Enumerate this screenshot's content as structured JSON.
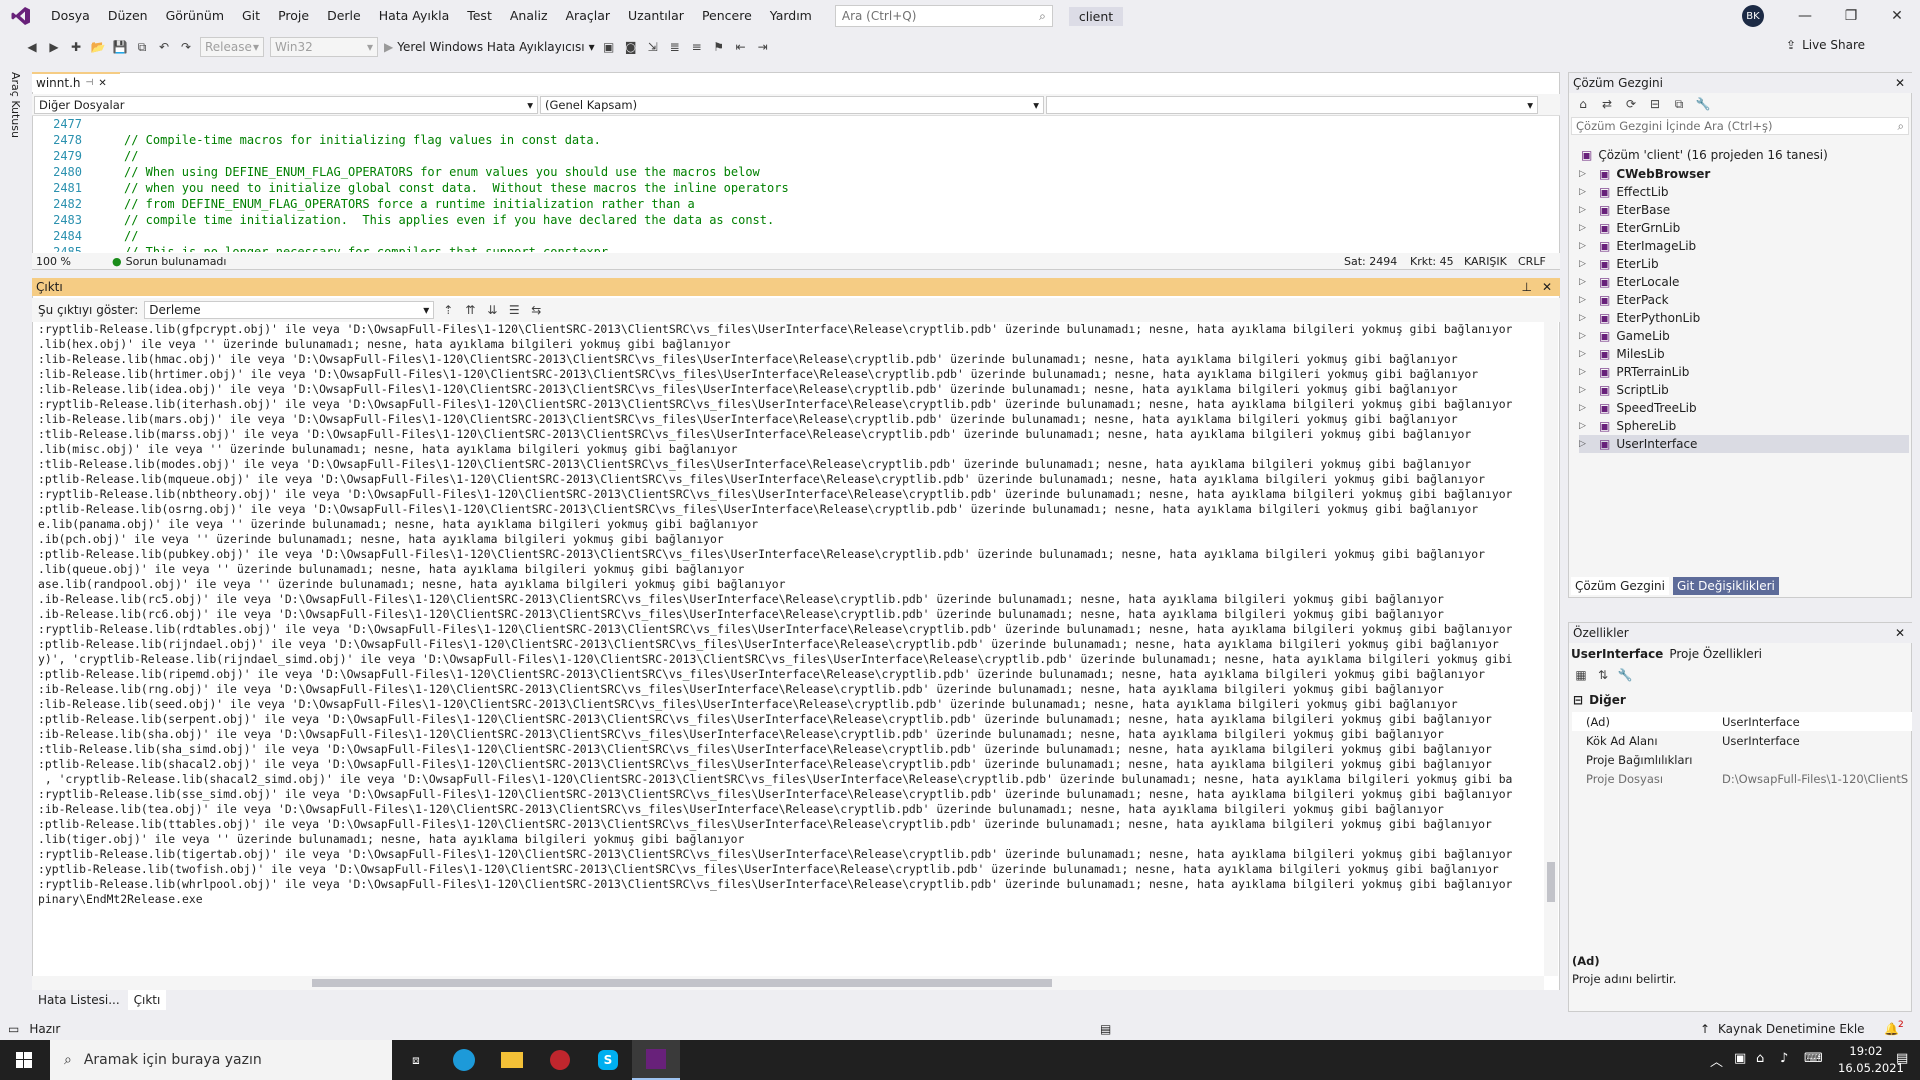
{
  "menu": [
    "Dosya",
    "Düzen",
    "Görünüm",
    "Git",
    "Proje",
    "Derle",
    "Hata Ayıkla",
    "Test",
    "Analiz",
    "Araçlar",
    "Uzantılar",
    "Pencere",
    "Yardım"
  ],
  "search": {
    "placeholder": "Ara (Ctrl+Q)"
  },
  "window_title": "client",
  "user_initials": "BK",
  "toolbar": {
    "config": "Release",
    "platform": "Win32",
    "debugger": "Yerel Windows Hata Ayıklayıcısı",
    "live_share": "Live Share"
  },
  "side_tab": "Araç Kutusu",
  "editor": {
    "tab": "winnt.h",
    "nav_left": "Diğer Dosyalar",
    "nav_mid": "(Genel Kapsam)",
    "lines": [
      {
        "n": "2477",
        "t": ""
      },
      {
        "n": "2478",
        "t": "// Compile-time macros for initializing flag values in const data."
      },
      {
        "n": "2479",
        "t": "//"
      },
      {
        "n": "2480",
        "t": "// When using DEFINE_ENUM_FLAG_OPERATORS for enum values you should use the macros below"
      },
      {
        "n": "2481",
        "t": "// when you need to initialize global const data.  Without these macros the inline operators"
      },
      {
        "n": "2482",
        "t": "// from DEFINE_ENUM_FLAG_OPERATORS force a runtime initialization rather than a"
      },
      {
        "n": "2483",
        "t": "// compile time initialization.  This applies even if you have declared the data as const."
      },
      {
        "n": "2484",
        "t": "//"
      },
      {
        "n": "2485",
        "t": "// This is no longer necessary for compilers that support constexpr."
      }
    ],
    "zoom": "100 %",
    "issues": "Sorun bulunamadı",
    "line": "Sat: 2494",
    "col": "Krkt: 45",
    "mode": "KARIŞIK",
    "eol": "CRLF"
  },
  "output": {
    "title": "Çıktı",
    "show_label": "Şu çıktıyı göster:",
    "source": "Derleme",
    "lines": [
      ":ryptlib-Release.lib(gfpcrypt.obj)' ile veya 'D:\\OwsapFull-Files\\1-120\\ClientSRC-2013\\ClientSRC\\vs_files\\UserInterface\\Release\\cryptlib.pdb' üzerinde bulunamadı; nesne, hata ayıklama bilgileri yokmuş gibi bağlanıyor",
      ".lib(hex.obj)' ile veya '' üzerinde bulunamadı; nesne, hata ayıklama bilgileri yokmuş gibi bağlanıyor",
      ":lib-Release.lib(hmac.obj)' ile veya 'D:\\OwsapFull-Files\\1-120\\ClientSRC-2013\\ClientSRC\\vs_files\\UserInterface\\Release\\cryptlib.pdb' üzerinde bulunamadı; nesne, hata ayıklama bilgileri yokmuş gibi bağlanıyor",
      ":lib-Release.lib(hrtimer.obj)' ile veya 'D:\\OwsapFull-Files\\1-120\\ClientSRC-2013\\ClientSRC\\vs_files\\UserInterface\\Release\\cryptlib.pdb' üzerinde bulunamadı; nesne, hata ayıklama bilgileri yokmuş gibi bağlanıyor",
      ":lib-Release.lib(idea.obj)' ile veya 'D:\\OwsapFull-Files\\1-120\\ClientSRC-2013\\ClientSRC\\vs_files\\UserInterface\\Release\\cryptlib.pdb' üzerinde bulunamadı; nesne, hata ayıklama bilgileri yokmuş gibi bağlanıyor",
      ":ryptlib-Release.lib(iterhash.obj)' ile veya 'D:\\OwsapFull-Files\\1-120\\ClientSRC-2013\\ClientSRC\\vs_files\\UserInterface\\Release\\cryptlib.pdb' üzerinde bulunamadı; nesne, hata ayıklama bilgileri yokmuş gibi bağlanıyor",
      ":lib-Release.lib(mars.obj)' ile veya 'D:\\OwsapFull-Files\\1-120\\ClientSRC-2013\\ClientSRC\\vs_files\\UserInterface\\Release\\cryptlib.pdb' üzerinde bulunamadı; nesne, hata ayıklama bilgileri yokmuş gibi bağlanıyor",
      ":tlib-Release.lib(marss.obj)' ile veya 'D:\\OwsapFull-Files\\1-120\\ClientSRC-2013\\ClientSRC\\vs_files\\UserInterface\\Release\\cryptlib.pdb' üzerinde bulunamadı; nesne, hata ayıklama bilgileri yokmuş gibi bağlanıyor",
      ".lib(misc.obj)' ile veya '' üzerinde bulunamadı; nesne, hata ayıklama bilgileri yokmuş gibi bağlanıyor",
      ":tlib-Release.lib(modes.obj)' ile veya 'D:\\OwsapFull-Files\\1-120\\ClientSRC-2013\\ClientSRC\\vs_files\\UserInterface\\Release\\cryptlib.pdb' üzerinde bulunamadı; nesne, hata ayıklama bilgileri yokmuş gibi bağlanıyor",
      ":ptlib-Release.lib(mqueue.obj)' ile veya 'D:\\OwsapFull-Files\\1-120\\ClientSRC-2013\\ClientSRC\\vs_files\\UserInterface\\Release\\cryptlib.pdb' üzerinde bulunamadı; nesne, hata ayıklama bilgileri yokmuş gibi bağlanıyor",
      ":ryptlib-Release.lib(nbtheory.obj)' ile veya 'D:\\OwsapFull-Files\\1-120\\ClientSRC-2013\\ClientSRC\\vs_files\\UserInterface\\Release\\cryptlib.pdb' üzerinde bulunamadı; nesne, hata ayıklama bilgileri yokmuş gibi bağlanıyor",
      ":ptlib-Release.lib(osrng.obj)' ile veya 'D:\\OwsapFull-Files\\1-120\\ClientSRC-2013\\ClientSRC\\vs_files\\UserInterface\\Release\\cryptlib.pdb' üzerinde bulunamadı; nesne, hata ayıklama bilgileri yokmuş gibi bağlanıyor",
      "e.lib(panama.obj)' ile veya '' üzerinde bulunamadı; nesne, hata ayıklama bilgileri yokmuş gibi bağlanıyor",
      ".ib(pch.obj)' ile veya '' üzerinde bulunamadı; nesne, hata ayıklama bilgileri yokmuş gibi bağlanıyor",
      ":ptlib-Release.lib(pubkey.obj)' ile veya 'D:\\OwsapFull-Files\\1-120\\ClientSRC-2013\\ClientSRC\\vs_files\\UserInterface\\Release\\cryptlib.pdb' üzerinde bulunamadı; nesne, hata ayıklama bilgileri yokmuş gibi bağlanıyor",
      ".lib(queue.obj)' ile veya '' üzerinde bulunamadı; nesne, hata ayıklama bilgileri yokmuş gibi bağlanıyor",
      "ase.lib(randpool.obj)' ile veya '' üzerinde bulunamadı; nesne, hata ayıklama bilgileri yokmuş gibi bağlanıyor",
      ".ib-Release.lib(rc5.obj)' ile veya 'D:\\OwsapFull-Files\\1-120\\ClientSRC-2013\\ClientSRC\\vs_files\\UserInterface\\Release\\cryptlib.pdb' üzerinde bulunamadı; nesne, hata ayıklama bilgileri yokmuş gibi bağlanıyor",
      ".ib-Release.lib(rc6.obj)' ile veya 'D:\\OwsapFull-Files\\1-120\\ClientSRC-2013\\ClientSRC\\vs_files\\UserInterface\\Release\\cryptlib.pdb' üzerinde bulunamadı; nesne, hata ayıklama bilgileri yokmuş gibi bağlanıyor",
      ":ryptlib-Release.lib(rdtables.obj)' ile veya 'D:\\OwsapFull-Files\\1-120\\ClientSRC-2013\\ClientSRC\\vs_files\\UserInterface\\Release\\cryptlib.pdb' üzerinde bulunamadı; nesne, hata ayıklama bilgileri yokmuş gibi bağlanıyor",
      ":ptlib-Release.lib(rijndael.obj)' ile veya 'D:\\OwsapFull-Files\\1-120\\ClientSRC-2013\\ClientSRC\\vs_files\\UserInterface\\Release\\cryptlib.pdb' üzerinde bulunamadı; nesne, hata ayıklama bilgileri yokmuş gibi bağlanıyor",
      "y)', 'cryptlib-Release.lib(rijndael_simd.obj)' ile veya 'D:\\OwsapFull-Files\\1-120\\ClientSRC-2013\\ClientSRC\\vs_files\\UserInterface\\Release\\cryptlib.pdb' üzerinde bulunamadı; nesne, hata ayıklama bilgileri yokmuş gibi",
      ":ptlib-Release.lib(ripemd.obj)' ile veya 'D:\\OwsapFull-Files\\1-120\\ClientSRC-2013\\ClientSRC\\vs_files\\UserInterface\\Release\\cryptlib.pdb' üzerinde bulunamadı; nesne, hata ayıklama bilgileri yokmuş gibi bağlanıyor",
      ":ib-Release.lib(rng.obj)' ile veya 'D:\\OwsapFull-Files\\1-120\\ClientSRC-2013\\ClientSRC\\vs_files\\UserInterface\\Release\\cryptlib.pdb' üzerinde bulunamadı; nesne, hata ayıklama bilgileri yokmuş gibi bağlanıyor",
      ":lib-Release.lib(seed.obj)' ile veya 'D:\\OwsapFull-Files\\1-120\\ClientSRC-2013\\ClientSRC\\vs_files\\UserInterface\\Release\\cryptlib.pdb' üzerinde bulunamadı; nesne, hata ayıklama bilgileri yokmuş gibi bağlanıyor",
      ":ptlib-Release.lib(serpent.obj)' ile veya 'D:\\OwsapFull-Files\\1-120\\ClientSRC-2013\\ClientSRC\\vs_files\\UserInterface\\Release\\cryptlib.pdb' üzerinde bulunamadı; nesne, hata ayıklama bilgileri yokmuş gibi bağlanıyor",
      ":ib-Release.lib(sha.obj)' ile veya 'D:\\OwsapFull-Files\\1-120\\ClientSRC-2013\\ClientSRC\\vs_files\\UserInterface\\Release\\cryptlib.pdb' üzerinde bulunamadı; nesne, hata ayıklama bilgileri yokmuş gibi bağlanıyor",
      ":tlib-Release.lib(sha_simd.obj)' ile veya 'D:\\OwsapFull-Files\\1-120\\ClientSRC-2013\\ClientSRC\\vs_files\\UserInterface\\Release\\cryptlib.pdb' üzerinde bulunamadı; nesne, hata ayıklama bilgileri yokmuş gibi bağlanıyor",
      ":ptlib-Release.lib(shacal2.obj)' ile veya 'D:\\OwsapFull-Files\\1-120\\ClientSRC-2013\\ClientSRC\\vs_files\\UserInterface\\Release\\cryptlib.pdb' üzerinde bulunamadı; nesne, hata ayıklama bilgileri yokmuş gibi bağlanıyor",
      " , 'cryptlib-Release.lib(shacal2_simd.obj)' ile veya 'D:\\OwsapFull-Files\\1-120\\ClientSRC-2013\\ClientSRC\\vs_files\\UserInterface\\Release\\cryptlib.pdb' üzerinde bulunamadı; nesne, hata ayıklama bilgileri yokmuş gibi ba",
      ":ryptlib-Release.lib(sse_simd.obj)' ile veya 'D:\\OwsapFull-Files\\1-120\\ClientSRC-2013\\ClientSRC\\vs_files\\UserInterface\\Release\\cryptlib.pdb' üzerinde bulunamadı; nesne, hata ayıklama bilgileri yokmuş gibi bağlanıyor",
      ":ib-Release.lib(tea.obj)' ile veya 'D:\\OwsapFull-Files\\1-120\\ClientSRC-2013\\ClientSRC\\vs_files\\UserInterface\\Release\\cryptlib.pdb' üzerinde bulunamadı; nesne, hata ayıklama bilgileri yokmuş gibi bağlanıyor",
      ":ptlib-Release.lib(ttables.obj)' ile veya 'D:\\OwsapFull-Files\\1-120\\ClientSRC-2013\\ClientSRC\\vs_files\\UserInterface\\Release\\cryptlib.pdb' üzerinde bulunamadı; nesne, hata ayıklama bilgileri yokmuş gibi bağlanıyor",
      ".lib(tiger.obj)' ile veya '' üzerinde bulunamadı; nesne, hata ayıklama bilgileri yokmuş gibi bağlanıyor",
      ":ryptlib-Release.lib(tigertab.obj)' ile veya 'D:\\OwsapFull-Files\\1-120\\ClientSRC-2013\\ClientSRC\\vs_files\\UserInterface\\Release\\cryptlib.pdb' üzerinde bulunamadı; nesne, hata ayıklama bilgileri yokmuş gibi bağlanıyor",
      ":yptlib-Release.lib(twofish.obj)' ile veya 'D:\\OwsapFull-Files\\1-120\\ClientSRC-2013\\ClientSRC\\vs_files\\UserInterface\\Release\\cryptlib.pdb' üzerinde bulunamadı; nesne, hata ayıklama bilgileri yokmuş gibi bağlanıyor",
      ":ryptlib-Release.lib(whrlpool.obj)' ile veya 'D:\\OwsapFull-Files\\1-120\\ClientSRC-2013\\ClientSRC\\vs_files\\UserInterface\\Release\\cryptlib.pdb' üzerinde bulunamadı; nesne, hata ayıklama bilgileri yokmuş gibi bağlanıyor",
      "pinary\\EndMt2Release.exe"
    ],
    "tab_errors": "Hata Listesi...",
    "tab_output": "Çıktı"
  },
  "solution": {
    "title": "Çözüm Gezgini",
    "search_placeholder": "Çözüm Gezgini İçinde Ara (Ctrl+ş)",
    "root": "Çözüm 'client' (16 projeden 16 tanesi)",
    "projects": [
      "CWebBrowser",
      "EffectLib",
      "EterBase",
      "EterGrnLib",
      "EterImageLib",
      "EterLib",
      "EterLocale",
      "EterPack",
      "EterPythonLib",
      "GameLib",
      "MilesLib",
      "PRTerrainLib",
      "ScriptLib",
      "SpeedTreeLib",
      "SphereLib",
      "UserInterface"
    ],
    "tab_solution": "Çözüm Gezgini",
    "tab_git": "Git Değişiklikleri"
  },
  "properties": {
    "title": "Özellikler",
    "object_name": "UserInterface",
    "object_type": "Proje Özellikleri",
    "category": "Diğer",
    "rows": [
      {
        "k": "(Ad)",
        "v": "UserInterface"
      },
      {
        "k": "Kök Ad Alanı",
        "v": "UserInterface"
      },
      {
        "k": "Proje Bağımlılıkları",
        "v": ""
      },
      {
        "k": "Proje Dosyası",
        "v": "D:\\OwsapFull-Files\\1-120\\ClientS"
      }
    ],
    "desc_title": "(Ad)",
    "desc_text": "Proje adını belirtir."
  },
  "status": {
    "ready": "Hazır",
    "source_control": "Kaynak Denetimine Ekle",
    "notifications": "2"
  },
  "taskbar": {
    "search": "Aramak için buraya yazın",
    "time": "19:02",
    "date": "16.05.2021"
  },
  "colors": {
    "accent": "#68217a",
    "tab_highlight": "#f5cc84",
    "comment": "#008000",
    "line_number": "#2b91af"
  }
}
